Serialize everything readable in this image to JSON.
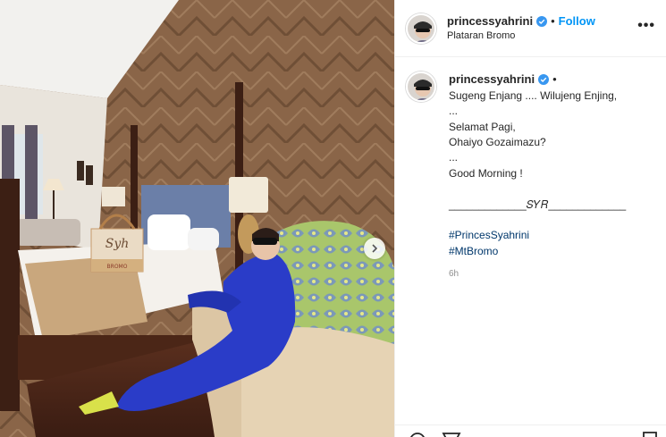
{
  "post": {
    "username": "princessyahrini",
    "follow_label": "Follow",
    "separator": "•",
    "location": "Plataran Bromo",
    "more_label": "•••",
    "caption": {
      "lines": [
        "Sugeng Enjang .... Wilujeng Enjing,",
        "...",
        "Selamat Pagi,",
        "Ohaiyo Gozaimazu?",
        "...",
        "Good Morning !",
        "",
        "_____________𝑆𝑌𝑅_____________",
        ""
      ],
      "hashtags": [
        "#PrincesSyahrini",
        "#MtBromo"
      ],
      "time": "6h"
    }
  },
  "photo": {
    "bag_text": "Syh",
    "bag_subtext": "BROMO"
  },
  "colors": {
    "link_blue": "#0095f6",
    "hashtag": "#00376b",
    "verified": "#3897f0"
  },
  "icons": [
    "verified-badge-icon",
    "chevron-right-icon",
    "more-options-icon",
    "comment-icon",
    "share-icon",
    "bookmark-icon"
  ]
}
